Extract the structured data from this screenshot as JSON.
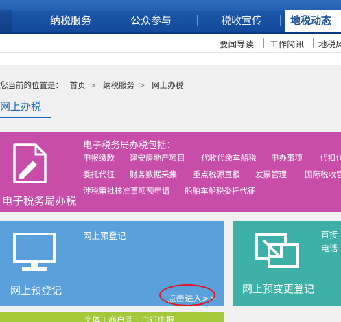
{
  "topnav": {
    "items": [
      "纳税服务",
      "公众参与",
      "税收宣传",
      "地税动态"
    ]
  },
  "subnav": {
    "items": [
      "要闻导读",
      "工作简讯",
      "地税风"
    ]
  },
  "breadcrumb": {
    "prefix": "您当前的位置是：",
    "home": "首页",
    "section": "纳税服务",
    "current": "网上办税"
  },
  "page_title": "网上办税",
  "etax": {
    "name": "电子税务局办税",
    "heading": "电子税务局办税包括：",
    "items": [
      "申报缴款",
      "建安房地产项目",
      "代收代缴车船税",
      "申办事项",
      "代扣代",
      "委托代征",
      "财务数据采集",
      "重点税源直报",
      "发票管理",
      "国际税收管",
      "涉税审批核准事项预申请",
      "船舶车船税委托代征"
    ]
  },
  "prereg": {
    "name": "网上预登记",
    "heading": "网上预登记",
    "enter": "点击进入>>"
  },
  "prechange": {
    "name": "网上预变更登记",
    "side1": "直接",
    "side2": "电话"
  },
  "green": {
    "text": "个体工商户网上自行申报"
  },
  "colors": {
    "nav": "#1a56a8",
    "magenta": "#c84da9",
    "blue": "#5aa0dc",
    "teal": "#3db0a7",
    "green": "#a3c93a",
    "highlight": "#e0161c"
  },
  "icons": [
    "document-pen-icon",
    "monitor-icon",
    "resize-window-icon"
  ]
}
